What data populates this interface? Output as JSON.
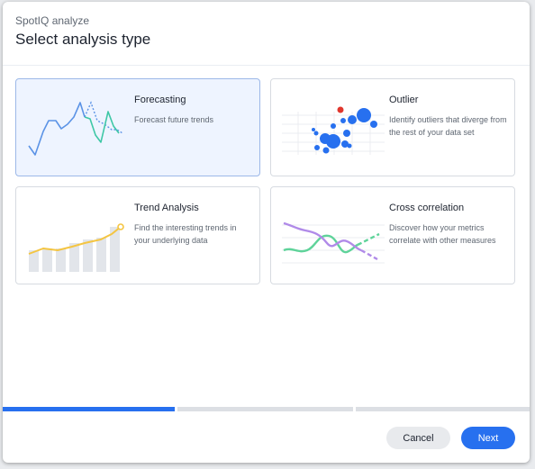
{
  "header": {
    "subtitle": "SpotIQ analyze",
    "title": "Select analysis type"
  },
  "cards": [
    {
      "title": "Forecasting",
      "description": "Forecast future trends",
      "selected": true,
      "icon": "forecast-line-chart-icon"
    },
    {
      "title": "Outlier",
      "description": "Identify outliers that diverge from the rest of your data set",
      "selected": false,
      "icon": "outlier-scatter-icon"
    },
    {
      "title": "Trend Analysis",
      "description": "Find the interesting trends in your underlying data",
      "selected": false,
      "icon": "trend-bar-line-icon"
    },
    {
      "title": "Cross correlation",
      "description": "Discover how your metrics correlate with other measures",
      "selected": false,
      "icon": "correlation-wave-icon"
    }
  ],
  "progress": {
    "steps": 3,
    "current_step": 1
  },
  "footer": {
    "cancel_label": "Cancel",
    "next_label": "Next"
  },
  "colors": {
    "accent": "#2770ef",
    "selected_card_bg": "#eef4ff",
    "outlier_red": "#e0362d",
    "trend_yellow": "#f4c542",
    "correlation_purple": "#b08ae8",
    "correlation_green": "#5fd39a",
    "forecast_teal": "#3ec7a6"
  }
}
